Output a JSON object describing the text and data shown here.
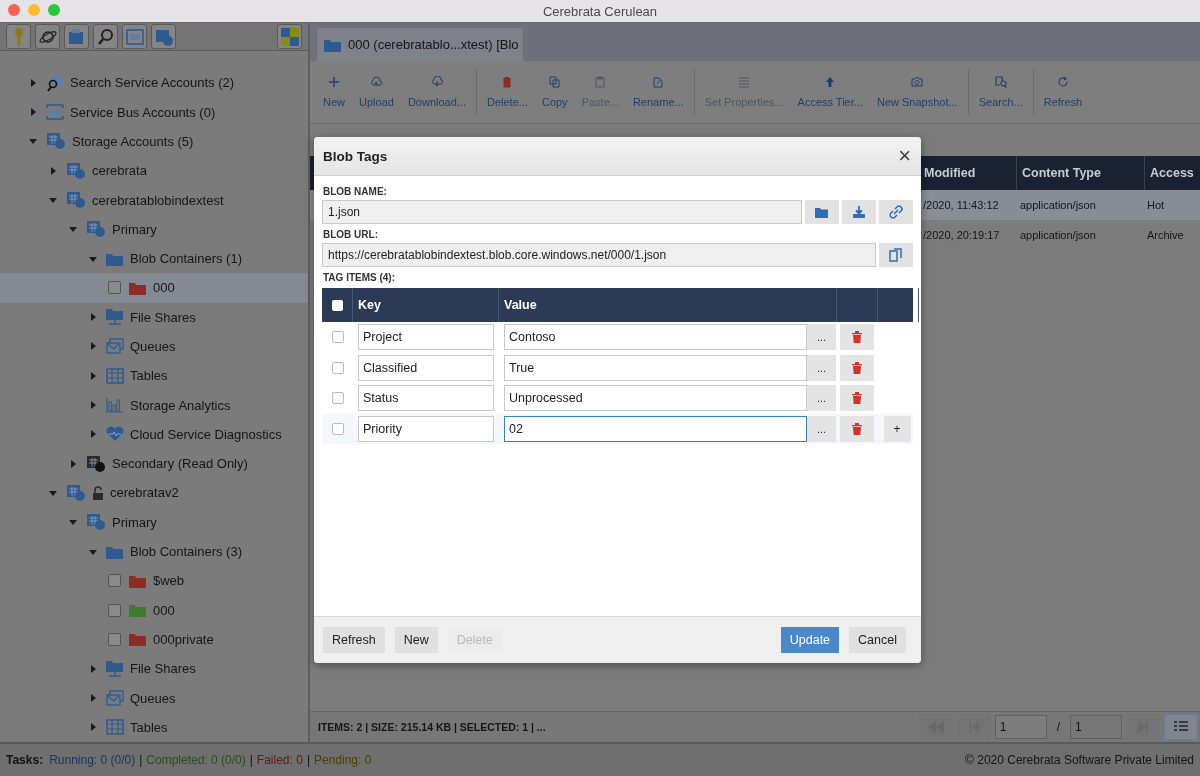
{
  "window": {
    "title": "Cerebrata Cerulean"
  },
  "sidebar": {
    "tree": [
      {
        "label": "Search Service Accounts (2)",
        "kind": "search",
        "expanded": false,
        "selected": false
      },
      {
        "label": "Service Bus Accounts (0)",
        "kind": "servicebus",
        "expanded": false,
        "selected": false
      },
      {
        "label": "Storage Accounts (5)",
        "kind": "storage",
        "expanded": true,
        "selected": false,
        "children": [
          {
            "label": "cerebrata",
            "kind": "account",
            "expanded": false,
            "locked": false,
            "selected": false
          },
          {
            "label": "cerebratablobindextest",
            "kind": "account",
            "expanded": true,
            "locked": false,
            "selected": false,
            "children": [
              {
                "label": "Primary",
                "kind": "account",
                "expanded": true,
                "locked": false,
                "selected": false,
                "children": [
                  {
                    "label": "Blob Containers (1)",
                    "kind": "folder",
                    "expanded": true,
                    "selected": false,
                    "children": [
                      {
                        "label": "000",
                        "kind": "container",
                        "color": "#8e2b24",
                        "checked": false,
                        "selected": true
                      }
                    ]
                  },
                  {
                    "label": "File Shares",
                    "kind": "fileshare",
                    "expanded": false,
                    "selected": false
                  },
                  {
                    "label": "Queues",
                    "kind": "queue",
                    "expanded": false,
                    "selected": false
                  },
                  {
                    "label": "Tables",
                    "kind": "table",
                    "expanded": false,
                    "selected": false
                  },
                  {
                    "label": "Storage Analytics",
                    "kind": "analytics",
                    "expanded": false,
                    "selected": false
                  },
                  {
                    "label": "Cloud Service Diagnostics",
                    "kind": "diagnostics",
                    "expanded": false,
                    "selected": false
                  }
                ]
              },
              {
                "label": "Secondary (Read Only)",
                "kind": "secondary",
                "expanded": false,
                "selected": false
              }
            ]
          },
          {
            "label": "cerebratav2",
            "kind": "account",
            "expanded": true,
            "locked": true,
            "selected": false,
            "children": [
              {
                "label": "Primary",
                "kind": "account",
                "expanded": true,
                "locked": false,
                "selected": false,
                "children": [
                  {
                    "label": "Blob Containers (3)",
                    "kind": "folder",
                    "expanded": true,
                    "selected": false,
                    "children": [
                      {
                        "label": "$web",
                        "kind": "container",
                        "color": "#8e2b24",
                        "checked": false,
                        "selected": false
                      },
                      {
                        "label": "000",
                        "kind": "container",
                        "color": "#3f7a2e",
                        "checked": false,
                        "selected": false
                      },
                      {
                        "label": "000private",
                        "kind": "container",
                        "color": "#8e2b24",
                        "checked": false,
                        "selected": false
                      }
                    ]
                  },
                  {
                    "label": "File Shares",
                    "kind": "fileshare",
                    "expanded": false,
                    "selected": false
                  },
                  {
                    "label": "Queues",
                    "kind": "queue",
                    "expanded": false,
                    "selected": false
                  },
                  {
                    "label": "Tables",
                    "kind": "table",
                    "expanded": false,
                    "selected": false
                  }
                ]
              }
            ]
          }
        ]
      }
    ]
  },
  "tabs": [
    {
      "label": "000 (cerebratablo...xtest) [Blo",
      "selected": true
    }
  ],
  "toolbar": [
    [
      {
        "label": "New",
        "kind": "plus",
        "disabled": false
      },
      {
        "label": "Upload",
        "kind": "upload",
        "disabled": false
      },
      {
        "label": "Download...",
        "kind": "download",
        "disabled": false
      }
    ],
    [
      {
        "label": "Delete...",
        "kind": "trash",
        "disabled": false
      },
      {
        "label": "Copy",
        "kind": "copy",
        "disabled": false
      },
      {
        "label": "Paste...",
        "kind": "paste",
        "disabled": true
      },
      {
        "label": "Rename...",
        "kind": "rename",
        "disabled": false
      }
    ],
    [
      {
        "label": "Set Properties...",
        "kind": "list",
        "disabled": true
      },
      {
        "label": "Access Tier...",
        "kind": "uparrow",
        "disabled": false
      },
      {
        "label": "New Snapshot...",
        "kind": "camera",
        "disabled": false
      }
    ],
    [
      {
        "label": "Search...",
        "kind": "search",
        "disabled": false
      }
    ],
    [
      {
        "label": "Refresh",
        "kind": "refresh",
        "disabled": false
      }
    ]
  ],
  "table": {
    "columns": [
      "Modified",
      "Content Type",
      "Access"
    ],
    "rows": [
      {
        "cells": [
          "/2020, 11:43:12",
          "application/json",
          "Hot"
        ],
        "selected": true
      },
      {
        "cells": [
          "/2020, 20:19:17",
          "application/json",
          "Archive"
        ],
        "selected": false
      }
    ]
  },
  "status_bar": {
    "text": "ITEMS: 2 | SIZE: 215.14 KB | SELECTED: 1 |  ...",
    "page": "1",
    "separator": "/",
    "total": "1"
  },
  "tasks": {
    "label": "Tasks:",
    "items": [
      {
        "text": "Running: 0 (0/0)",
        "color": "#17355f",
        "separator": "|"
      },
      {
        "text": "Completed: 0 (0/0)",
        "color": "#244f18",
        "separator": "|"
      },
      {
        "text": "Failed: 0",
        "color": "#641713",
        "separator": "|"
      },
      {
        "text": "Pending: 0",
        "color": "#4a3f00"
      }
    ],
    "copyright": "© 2020 Cerebrata Software Private Limited"
  },
  "dialog": {
    "title": "Blob Tags",
    "close": "×",
    "name_label": "BLOB NAME:",
    "name_value": "1.json",
    "url_label": "BLOB URL:",
    "url_value": "https://cerebratablobindextest.blob.core.windows.net/000/1.json",
    "tags_label": "TAG ITEMS (4):",
    "columns": [
      "Key",
      "Value"
    ],
    "header_checked": false,
    "tags": [
      {
        "key": "Project",
        "value": "Contoso",
        "checked": false,
        "focused": false,
        "more": "..."
      },
      {
        "key": "Classified",
        "value": "True",
        "checked": false,
        "focused": false,
        "more": "..."
      },
      {
        "key": "Status",
        "value": "Unprocessed",
        "checked": false,
        "focused": false,
        "more": "..."
      },
      {
        "key": "Priority",
        "value": "02",
        "checked": false,
        "focused": true,
        "more": "...",
        "add": "+"
      }
    ],
    "buttons": [
      {
        "label": "Refresh",
        "kind": "action",
        "disabled": false
      },
      {
        "label": "New",
        "kind": "action",
        "disabled": false
      },
      {
        "label": "Delete",
        "kind": "action",
        "disabled": true
      },
      {
        "label": "Update",
        "kind": "primary",
        "disabled": false
      },
      {
        "label": "Cancel",
        "kind": "dismiss",
        "disabled": false
      }
    ]
  }
}
